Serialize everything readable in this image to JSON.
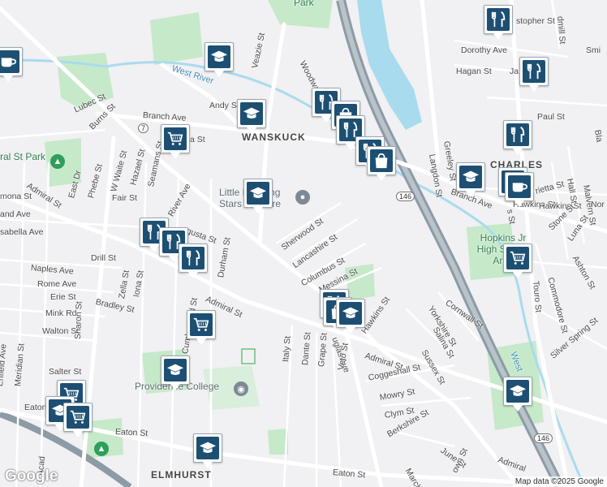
{
  "map": {
    "attribution": "Map data ©2025 Google",
    "google_logo": "Google",
    "colors": {
      "background": "#f1f0f3",
      "park": "#c6e9c9",
      "water": "#a9dbee",
      "highway": "#8c9ba5",
      "road": "#ffffff",
      "marker_fill": "#1d4f73"
    },
    "neighborhoods": [
      {
        "id": "wanskuck",
        "name": "WANSKUCK"
      },
      {
        "id": "charles",
        "name": "CHARLES"
      },
      {
        "id": "elmhurst",
        "name": "ELMHURST"
      }
    ],
    "water_labels": [
      {
        "id": "west-river",
        "name": "West River"
      },
      {
        "id": "west-river-2",
        "name": "West"
      }
    ],
    "park_labels": [
      {
        "id": "park-top",
        "name": "Park"
      },
      {
        "id": "central-st-park",
        "name": "ral St Park"
      }
    ],
    "poi_labels": [
      {
        "id": "providence-college",
        "name": "Providence College"
      },
      {
        "id": "little-learning",
        "name": "Little Learning Stars Daycare"
      },
      {
        "id": "hopkins",
        "name": "Hopkins Jr High School Area"
      }
    ],
    "shields": [
      {
        "id": "route-7",
        "name": "7"
      },
      {
        "id": "route-146-a",
        "name": "146"
      },
      {
        "id": "route-146-b",
        "name": "146"
      }
    ],
    "streets": [
      {
        "id": "woodward-rd",
        "name": "Woodward Rd"
      },
      {
        "id": "veazie-st",
        "name": "Veazie St"
      },
      {
        "id": "branch-ave",
        "name": "Branch Ave"
      },
      {
        "id": "branch-ave-2",
        "name": "Branch Ave"
      },
      {
        "id": "andy-st",
        "name": "Andy St"
      },
      {
        "id": "lubec-st",
        "name": "Lubec St"
      },
      {
        "id": "burns-st",
        "name": "Burns St"
      },
      {
        "id": "admiral-st-w",
        "name": "Admiral St"
      },
      {
        "id": "admiral-st-mid",
        "name": "Admiral St"
      },
      {
        "id": "admiral-st-e",
        "name": "Admiral St"
      },
      {
        "id": "admiral-st-se",
        "name": "Admiral"
      },
      {
        "id": "east-dr",
        "name": "East Dr"
      },
      {
        "id": "phebe-st",
        "name": "Phebe St"
      },
      {
        "id": "w-waite-st",
        "name": "W Waite St"
      },
      {
        "id": "hazael-st",
        "name": "Hazael St"
      },
      {
        "id": "seamans-st",
        "name": "Seamans St"
      },
      {
        "id": "fair-st",
        "name": "Fair St"
      },
      {
        "id": "river-ave",
        "name": "River Ave"
      },
      {
        "id": "ramona-st",
        "name": "mona St"
      },
      {
        "id": "roland-ave",
        "name": "and Ave"
      },
      {
        "id": "isabella-ave",
        "name": "sabella Ave"
      },
      {
        "id": "augusta-st",
        "name": "gusta St"
      },
      {
        "id": "naples-ave",
        "name": "Naples Ave"
      },
      {
        "id": "drill-st",
        "name": "Drill St"
      },
      {
        "id": "rome-ave",
        "name": "Rome Ave"
      },
      {
        "id": "erie-st",
        "name": "Erie St"
      },
      {
        "id": "mink-rd",
        "name": "Mink Rd"
      },
      {
        "id": "bradley-st",
        "name": "Bradley St"
      },
      {
        "id": "walton-st",
        "name": "Walton St"
      },
      {
        "id": "zella-st",
        "name": "Zella St"
      },
      {
        "id": "iona-st",
        "name": "Iona St"
      },
      {
        "id": "sharon-st",
        "name": "Sharon St"
      },
      {
        "id": "durham-st",
        "name": "Durham St"
      },
      {
        "id": "cumberland-st",
        "name": "Cumberland St"
      },
      {
        "id": "salter-st",
        "name": "Salter St"
      },
      {
        "id": "eaton-st-w",
        "name": "Eaton"
      },
      {
        "id": "eaton-st",
        "name": "Eaton St"
      },
      {
        "id": "eaton-st-2",
        "name": "Eaton St"
      },
      {
        "id": "enfield-ave",
        "name": "Enfield Ave"
      },
      {
        "id": "meridian-st",
        "name": "Meridian St"
      },
      {
        "id": "academy-ave",
        "name": "Acad"
      },
      {
        "id": "sherwood-st",
        "name": "Sherwood St"
      },
      {
        "id": "lancashire-st",
        "name": "Lancashire St"
      },
      {
        "id": "columbus-st",
        "name": "Columbus St"
      },
      {
        "id": "messina-st",
        "name": "Messina St"
      },
      {
        "id": "douglas-ave",
        "name": "uglas Ave"
      },
      {
        "id": "italy-st",
        "name": "Italy St"
      },
      {
        "id": "dante-st",
        "name": "Dante St"
      },
      {
        "id": "grape-st",
        "name": "Grape St"
      },
      {
        "id": "veto-st",
        "name": "Veto St"
      },
      {
        "id": "hawkins-st",
        "name": "Hawkins St"
      },
      {
        "id": "hawkins-st-2",
        "name": "Hawkins St"
      },
      {
        "id": "coggeshall-st",
        "name": "Coggeshall St"
      },
      {
        "id": "mowry-st",
        "name": "Mowry St"
      },
      {
        "id": "clym-st",
        "name": "Clym St"
      },
      {
        "id": "berkshire-st",
        "name": "Berkshire St"
      },
      {
        "id": "june-st",
        "name": "June St"
      },
      {
        "id": "march-st",
        "name": "March"
      },
      {
        "id": "brown-st",
        "name": "own St"
      },
      {
        "id": "sussex-st",
        "name": "Sussex St"
      },
      {
        "id": "salina-st",
        "name": "Salina St"
      },
      {
        "id": "yorkshire-st",
        "name": "Yorkshire St"
      },
      {
        "id": "cornwall-st",
        "name": "Cornwall St"
      },
      {
        "id": "christopher-st",
        "name": "stopher St"
      },
      {
        "id": "dorothy-ave",
        "name": "Dorothy Ave"
      },
      {
        "id": "hagan-st",
        "name": "Hagan St"
      },
      {
        "id": "greeley-st",
        "name": "Greeley St"
      },
      {
        "id": "langdon-st",
        "name": "Langdon St"
      },
      {
        "id": "paul-st",
        "name": "Paul St"
      },
      {
        "id": "henrietta-st",
        "name": "rietta St"
      },
      {
        "id": "hawkins-e",
        "name": "Hawkins St"
      },
      {
        "id": "hall-st",
        "name": "Hall St"
      },
      {
        "id": "malvern-st",
        "name": "Malvern St"
      },
      {
        "id": "stone-st",
        "name": "Stone St"
      },
      {
        "id": "luna-st",
        "name": "Luna St"
      },
      {
        "id": "ashton-st",
        "name": "Ashton St"
      },
      {
        "id": "commodore-st",
        "name": "Commodore St"
      },
      {
        "id": "touro-st",
        "name": "Touro St"
      },
      {
        "id": "silver-spring-st",
        "name": "Silver Spring St"
      },
      {
        "id": "windmill-st",
        "name": "dmill St"
      },
      {
        "id": "smith-st",
        "name": "Smi"
      },
      {
        "id": "norfolk",
        "name": "Nor"
      },
      {
        "id": "ja-st",
        "name": "Ja"
      },
      {
        "id": "bla",
        "name": "Bla"
      },
      {
        "id": "s-st",
        "name": "s St"
      },
      {
        "id": "ia-st",
        "name": "a St"
      }
    ],
    "markers": [
      {
        "id": "m1",
        "type": "cafe"
      },
      {
        "id": "m2",
        "type": "school"
      },
      {
        "id": "m3",
        "type": "school"
      },
      {
        "id": "m4",
        "type": "grocery"
      },
      {
        "id": "m5",
        "type": "school"
      },
      {
        "id": "m6",
        "type": "restaurant"
      },
      {
        "id": "m7",
        "type": "restaurant"
      },
      {
        "id": "m8",
        "type": "restaurant"
      },
      {
        "id": "m9",
        "type": "restaurant"
      },
      {
        "id": "m10",
        "type": "shopping"
      },
      {
        "id": "m11",
        "type": "restaurant"
      },
      {
        "id": "m12",
        "type": "restaurant"
      },
      {
        "id": "m13",
        "type": "shopping"
      },
      {
        "id": "m14",
        "type": "restaurant"
      },
      {
        "id": "m15",
        "type": "shopping"
      },
      {
        "id": "m16",
        "type": "school"
      },
      {
        "id": "m17",
        "type": "grocery"
      },
      {
        "id": "m18",
        "type": "school"
      },
      {
        "id": "m19",
        "type": "grocery"
      },
      {
        "id": "m20",
        "type": "school"
      },
      {
        "id": "m21",
        "type": "grocery"
      },
      {
        "id": "m22",
        "type": "school"
      },
      {
        "id": "m23",
        "type": "restaurant"
      },
      {
        "id": "m24",
        "type": "restaurant"
      },
      {
        "id": "m25",
        "type": "restaurant"
      },
      {
        "id": "m26",
        "type": "school"
      },
      {
        "id": "m27",
        "type": "school"
      },
      {
        "id": "m28",
        "type": "cafe"
      },
      {
        "id": "m29",
        "type": "grocery"
      },
      {
        "id": "m30",
        "type": "school"
      }
    ]
  }
}
